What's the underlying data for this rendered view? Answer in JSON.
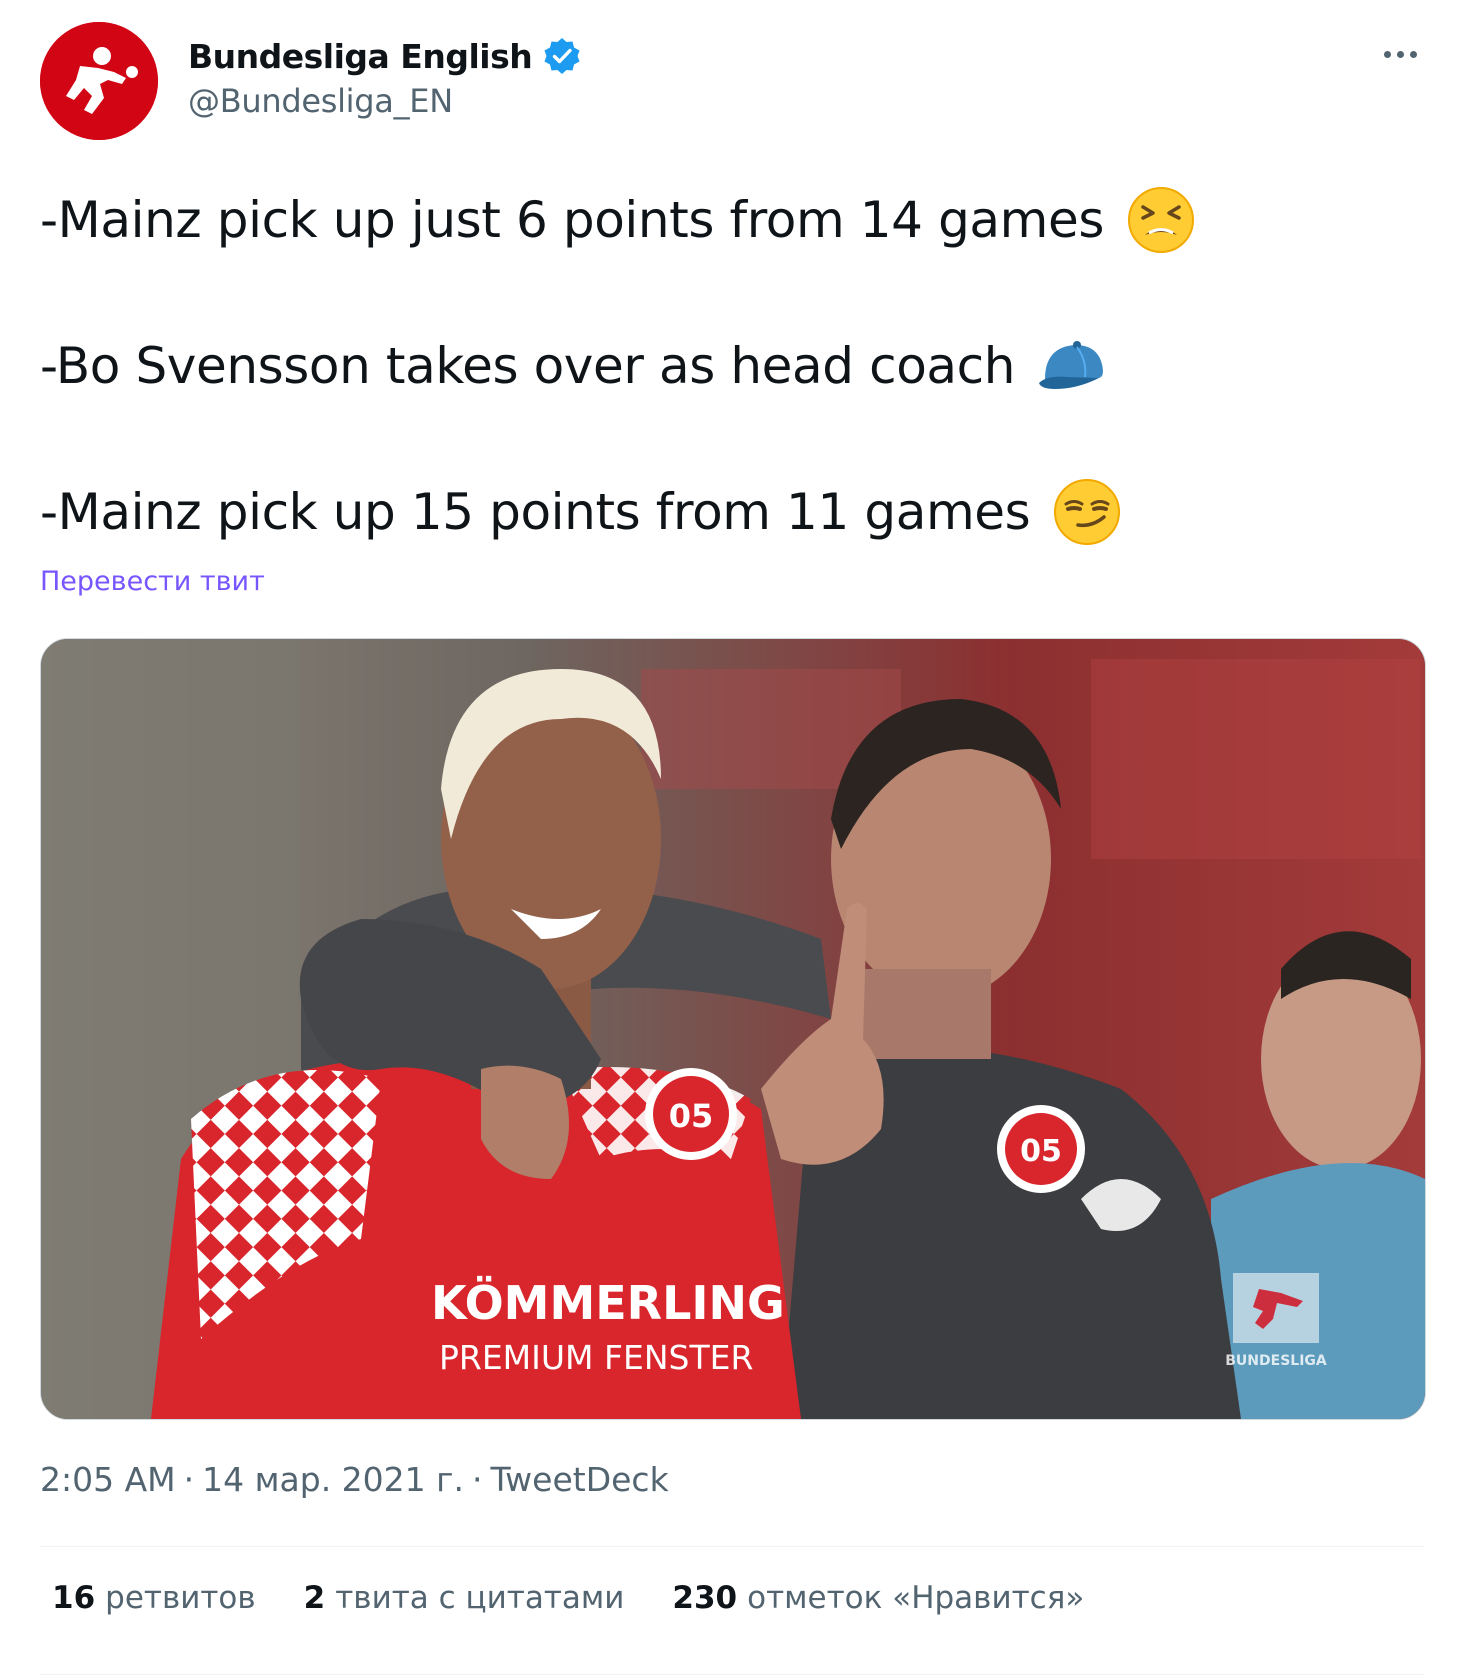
{
  "author": {
    "display_name": "Bundesliga English",
    "handle": "@Bundesliga_EN",
    "verified": true,
    "avatar_icon": "bundesliga-logo-icon",
    "avatar_color": "#d20515"
  },
  "more_icon": "more-horizontal-icon",
  "tweet": {
    "lines": [
      {
        "text": "-Mainz pick up just 6 points from 14 games",
        "emoji": "tired-face-emoji"
      },
      {
        "text": "-Bo Svensson takes over as head coach",
        "emoji": "billed-cap-emoji"
      },
      {
        "text": "-Mainz pick up 15 points from 11 games",
        "emoji": "smirking-face-emoji"
      }
    ],
    "translate_label": "Перевести твит"
  },
  "media": {
    "jersey_sponsor_line1": "KÖMMERLING",
    "jersey_sponsor_line2": "PREMIUM FENSTER",
    "club_badge_text": "05",
    "watermark_text": "BUNDESLIGA"
  },
  "meta": {
    "time": "2:05 AM",
    "separator": "·",
    "date": "14 мар. 2021 г.",
    "source": "TweetDeck"
  },
  "stats": {
    "retweets": {
      "count": "16",
      "label": "ретвитов"
    },
    "quotes": {
      "count": "2",
      "label": "твита с цитатами"
    },
    "likes": {
      "count": "230",
      "label": "отметок «Нравится»"
    }
  },
  "colors": {
    "text_primary": "#0f1419",
    "text_secondary": "#536471",
    "link_purple": "#7856ff",
    "verified_blue": "#1d9bf0",
    "mainz_red": "#d9262c"
  }
}
